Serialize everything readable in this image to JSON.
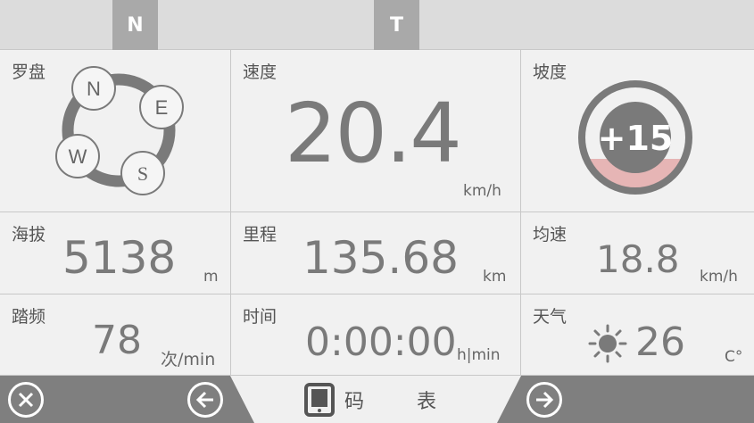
{
  "tabs": {
    "n_label": "N",
    "t_label": "T"
  },
  "compass": {
    "label": "罗盘",
    "dirs": {
      "n": "N",
      "e": "E",
      "w": "W",
      "s": "S"
    }
  },
  "speed": {
    "label": "速度",
    "value": "20.4",
    "unit": "km/h"
  },
  "slope": {
    "label": "坡度",
    "value": "+15",
    "level": 0.15
  },
  "altitude": {
    "label": "海拔",
    "value": "5138",
    "unit": "m"
  },
  "distance": {
    "label": "里程",
    "value": "135.68",
    "unit": "km"
  },
  "avg_speed": {
    "label": "均速",
    "value": "18.8",
    "unit": "km/h"
  },
  "cadence": {
    "label": "踏频",
    "value": "78",
    "unit": "次/min"
  },
  "time": {
    "label": "时间",
    "value": "0:00:00",
    "unit": "h|min"
  },
  "weather": {
    "label": "天气",
    "value": "26",
    "unit": "C°",
    "icon": "sun-icon"
  },
  "bottom": {
    "title": "码 表",
    "icons": [
      "close-icon",
      "back-arrow-icon",
      "tablet-icon",
      "forward-arrow-icon"
    ]
  },
  "colors": {
    "dark_gray": "#7f7f7f",
    "tab_gray": "#a9a9a9",
    "slope_fill": "#e6b5b5",
    "bg": "#f1f1f1"
  }
}
